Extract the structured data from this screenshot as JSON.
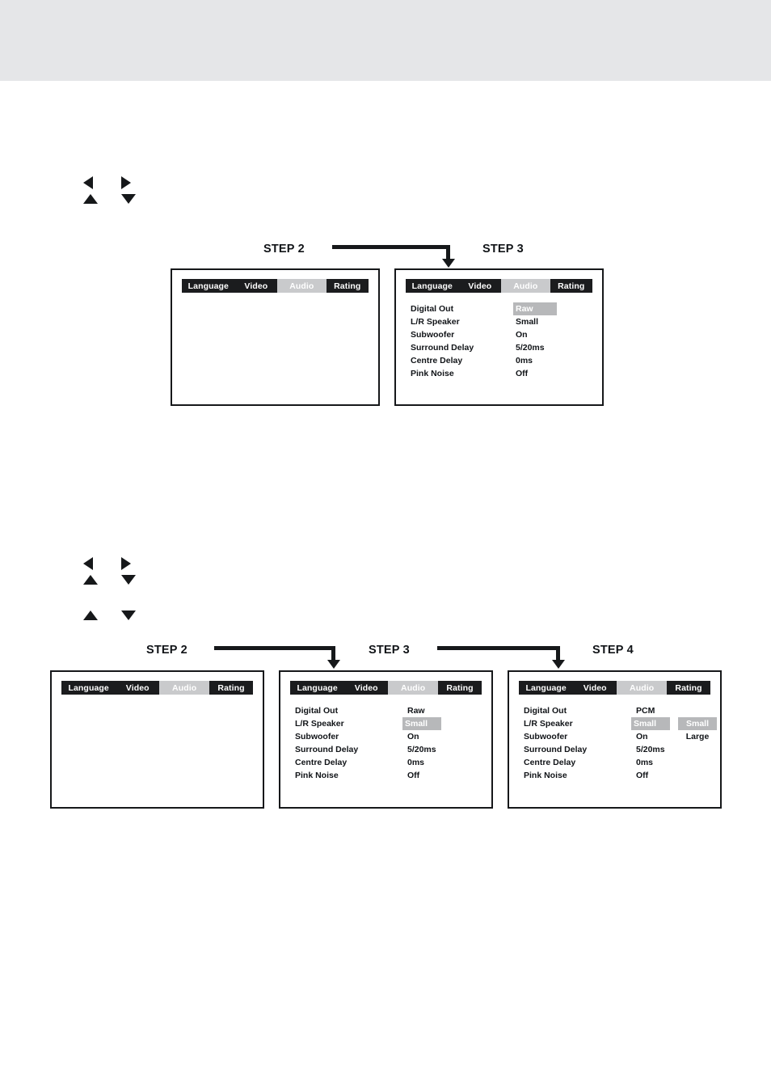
{
  "menu_tabs": [
    "Language",
    "Video",
    "Audio",
    "Rating"
  ],
  "selected_tab": "Audio",
  "arrow_icons": {
    "left": "triangle-left",
    "right": "triangle-right",
    "up": "triangle-up",
    "down": "triangle-down"
  },
  "colors": {
    "band": "#e5e6e8",
    "menubar_bg": "#1b1c1e",
    "menubar_text": "#ffffff",
    "highlight_bg": "#b7b8ba",
    "highlight_text": "#ffffff",
    "ink": "#16181a"
  },
  "section_top": {
    "steps": [
      {
        "label": "STEP 2"
      },
      {
        "label": "STEP 3"
      }
    ],
    "screens": [
      {
        "id": "top-step2",
        "tabs": [
          "Language",
          "Video",
          "Audio",
          "Rating"
        ],
        "selected": "Audio",
        "rows": []
      },
      {
        "id": "top-step3",
        "tabs": [
          "Language",
          "Video",
          "Audio",
          "Rating"
        ],
        "selected": "Audio",
        "rows": [
          {
            "label": "Digital Out",
            "value": "Raw",
            "highlight": true
          },
          {
            "label": "L/R Speaker",
            "value": "Small",
            "highlight": false
          },
          {
            "label": "Subwoofer",
            "value": "On",
            "highlight": false
          },
          {
            "label": "Surround Delay",
            "value": "5/20ms",
            "highlight": false
          },
          {
            "label": "Centre Delay",
            "value": "0ms",
            "highlight": false
          },
          {
            "label": "Pink Noise",
            "value": "Off",
            "highlight": false
          }
        ]
      }
    ]
  },
  "section_bottom": {
    "steps": [
      {
        "label": "STEP 2"
      },
      {
        "label": "STEP 3"
      },
      {
        "label": "STEP 4"
      }
    ],
    "screens": [
      {
        "id": "bot-step2",
        "tabs": [
          "Language",
          "Video",
          "Audio",
          "Rating"
        ],
        "selected": "Audio",
        "rows": []
      },
      {
        "id": "bot-step3",
        "tabs": [
          "Language",
          "Video",
          "Audio",
          "Rating"
        ],
        "selected": "Audio",
        "rows": [
          {
            "label": "Digital Out",
            "value": "Raw",
            "highlight": false
          },
          {
            "label": "L/R Speaker",
            "value": "Small",
            "highlight": true
          },
          {
            "label": "Subwoofer",
            "value": "On",
            "highlight": false
          },
          {
            "label": "Surround Delay",
            "value": "5/20ms",
            "highlight": false
          },
          {
            "label": "Centre Delay",
            "value": "0ms",
            "highlight": false
          },
          {
            "label": "Pink Noise",
            "value": "Off",
            "highlight": false
          }
        ]
      },
      {
        "id": "bot-step4",
        "tabs": [
          "Language",
          "Video",
          "Audio",
          "Rating"
        ],
        "selected": "Audio",
        "rows": [
          {
            "label": "Digital Out",
            "value": "PCM",
            "highlight": false
          },
          {
            "label": "L/R Speaker",
            "value": "Small",
            "highlight": true
          },
          {
            "label": "Subwoofer",
            "value": "On",
            "highlight": false
          },
          {
            "label": "Surround Delay",
            "value": "5/20ms",
            "highlight": false
          },
          {
            "label": "Centre Delay",
            "value": "0ms",
            "highlight": false
          },
          {
            "label": "Pink Noise",
            "value": "Off",
            "highlight": false
          }
        ],
        "popup_options": [
          {
            "value": "Small",
            "highlight": true
          },
          {
            "value": "Large",
            "highlight": false
          }
        ]
      }
    ]
  }
}
